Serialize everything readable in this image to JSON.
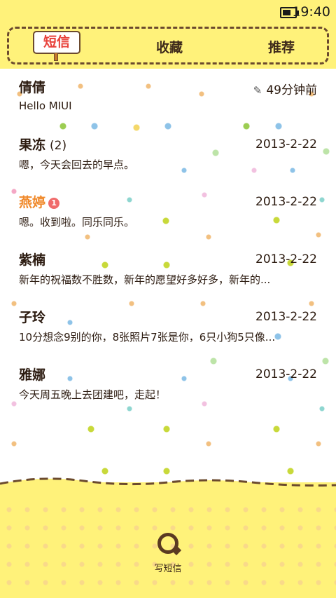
{
  "status": {
    "time": "19:40"
  },
  "tabs": [
    {
      "label": "短信",
      "active": true
    },
    {
      "label": "收藏"
    },
    {
      "label": "推荐"
    }
  ],
  "messages": [
    {
      "name": "倩倩",
      "time": "49分钟前",
      "preview": "Hello MIUI",
      "draft": true
    },
    {
      "name": "果冻",
      "count": "(2)",
      "time": "2013-2-22",
      "preview": "嗯，今天会回去的早点。"
    },
    {
      "name": "燕婷",
      "unread": "1",
      "time": "2013-2-22",
      "preview": "嗯。收到啦。同乐同乐。",
      "name_color": "#f08a2c"
    },
    {
      "name": "紫楠",
      "time": "2013-2-22",
      "preview": "新年的祝福数不胜数，新年的愿望好多好多，新年的..."
    },
    {
      "name": "子玲",
      "time": "2013-2-22",
      "preview": "10分想念9别的你，8张照片7张是你，6只小狗5只像..."
    },
    {
      "name": "雅娜",
      "time": "2013-2-22",
      "preview": "今天周五晚上去团建吧，走起！"
    }
  ],
  "compose": {
    "label": "写短信"
  },
  "colors": {
    "header_bg": "#fff27a",
    "accent_red": "#e8413a",
    "brown": "#6b4a2e"
  }
}
